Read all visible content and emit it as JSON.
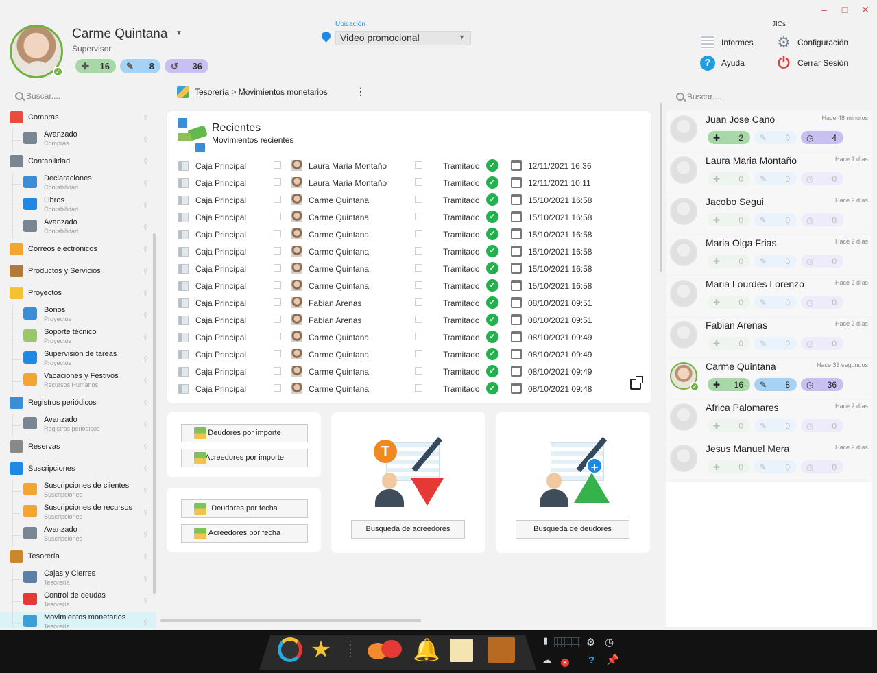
{
  "window": {
    "minimize": "–",
    "maximize": "□",
    "close": "✕"
  },
  "profile": {
    "name": "Carme Quintana",
    "role": "Supervisor",
    "badges": {
      "created": "16",
      "edited": "8",
      "history": "36"
    }
  },
  "location": {
    "label": "Ubicación",
    "value": "Video promocional"
  },
  "topmenu": {
    "group_label": "JICs",
    "informes": "Informes",
    "configuracion": "Configuración",
    "ayuda": "Ayuda",
    "cerrar": "Cerrar Sesión"
  },
  "sidebar": {
    "search_placeholder": "Buscar....",
    "items": [
      {
        "label": "Compras",
        "type": "top",
        "color": "#e74c3c"
      },
      {
        "label": "Avanzado",
        "sub": "Compras",
        "type": "sub",
        "color": "#7a8793"
      },
      {
        "label": "Contabilidad",
        "type": "top",
        "color": "#7a8793"
      },
      {
        "label": "Declaraciones",
        "sub": "Contabilidad",
        "type": "sub",
        "color": "#3b8ed6"
      },
      {
        "label": "Libros",
        "sub": "Contabilidad",
        "type": "sub",
        "color": "#1e88e5"
      },
      {
        "label": "Avanzado",
        "sub": "Contabilidad",
        "type": "sub",
        "color": "#7a8793"
      },
      {
        "label": "Correos electrónicos",
        "type": "top",
        "color": "#f2a530"
      },
      {
        "label": "Productos y Servicios",
        "type": "top",
        "color": "#b07a3a"
      },
      {
        "label": "Proyectos",
        "type": "top",
        "color": "#f2c230"
      },
      {
        "label": "Bonos",
        "sub": "Proyectos",
        "type": "sub",
        "color": "#3b8ed6"
      },
      {
        "label": "Soporte técnico",
        "sub": "Proyectos",
        "type": "sub",
        "color": "#9bc76a"
      },
      {
        "label": "Supervisión de tareas",
        "sub": "Proyectos",
        "type": "sub",
        "color": "#1e88e5"
      },
      {
        "label": "Vacaciones y Festivos",
        "sub": "Recursos Humanos",
        "type": "sub",
        "color": "#f2a530"
      },
      {
        "label": "Registros periódicos",
        "type": "top",
        "color": "#3b8ed6"
      },
      {
        "label": "Avanzado",
        "sub": "Registros periódicos",
        "type": "sub",
        "color": "#7a8793"
      },
      {
        "label": "Reservas",
        "type": "top",
        "color": "#888888"
      },
      {
        "label": "Suscripciones",
        "type": "top",
        "color": "#1e88e5"
      },
      {
        "label": "Suscripciones de clientes",
        "sub": "Suscripciones",
        "type": "sub",
        "color": "#f2a530"
      },
      {
        "label": "Suscripciones de recursos",
        "sub": "Suscripciones",
        "type": "sub",
        "color": "#f2a530"
      },
      {
        "label": "Avanzado",
        "sub": "Suscripciones",
        "type": "sub",
        "color": "#7a8793"
      },
      {
        "label": "Tesorería",
        "type": "top",
        "color": "#c9882e"
      },
      {
        "label": "Cajas y Cierres",
        "sub": "Tesorería",
        "type": "sub",
        "color": "#5b7fa6"
      },
      {
        "label": "Control de deudas",
        "sub": "Tesorería",
        "type": "sub",
        "color": "#e53935"
      },
      {
        "label": "Movimientos monetarios",
        "sub": "Tesorería",
        "type": "sub",
        "color": "#3ca0d8",
        "active": true
      }
    ]
  },
  "breadcrumb": {
    "text": "Tesorería > Movimientos monetarios",
    "more": "⋮"
  },
  "recent": {
    "title": "Recientes",
    "subtitle": "Movimientos recientes",
    "rows": [
      {
        "name": "Caja Principal",
        "user": "Laura Maria Montaño",
        "status": "Tramitado",
        "date": "12/11/2021 16:36"
      },
      {
        "name": "Caja Principal",
        "user": "Laura Maria Montaño",
        "status": "Tramitado",
        "date": "12/11/2021 10:11"
      },
      {
        "name": "Caja Principal",
        "user": "Carme Quintana",
        "status": "Tramitado",
        "date": "15/10/2021 16:58"
      },
      {
        "name": "Caja Principal",
        "user": "Carme Quintana",
        "status": "Tramitado",
        "date": "15/10/2021 16:58"
      },
      {
        "name": "Caja Principal",
        "user": "Carme Quintana",
        "status": "Tramitado",
        "date": "15/10/2021 16:58"
      },
      {
        "name": "Caja Principal",
        "user": "Carme Quintana",
        "status": "Tramitado",
        "date": "15/10/2021 16:58"
      },
      {
        "name": "Caja Principal",
        "user": "Carme Quintana",
        "status": "Tramitado",
        "date": "15/10/2021 16:58"
      },
      {
        "name": "Caja Principal",
        "user": "Carme Quintana",
        "status": "Tramitado",
        "date": "15/10/2021 16:58"
      },
      {
        "name": "Caja Principal",
        "user": "Fabian Arenas",
        "status": "Tramitado",
        "date": "08/10/2021 09:51"
      },
      {
        "name": "Caja Principal",
        "user": "Fabian Arenas",
        "status": "Tramitado",
        "date": "08/10/2021 09:51"
      },
      {
        "name": "Caja Principal",
        "user": "Carme Quintana",
        "status": "Tramitado",
        "date": "08/10/2021 09:49"
      },
      {
        "name": "Caja Principal",
        "user": "Carme Quintana",
        "status": "Tramitado",
        "date": "08/10/2021 09:49"
      },
      {
        "name": "Caja Principal",
        "user": "Carme Quintana",
        "status": "Tramitado",
        "date": "08/10/2021 09:49"
      },
      {
        "name": "Caja Principal",
        "user": "Carme Quintana",
        "status": "Tramitado",
        "date": "08/10/2021 09:48"
      }
    ]
  },
  "cards": {
    "deudores_importe": "Deudores por importe",
    "acreedores_importe": "Acreedores por importe",
    "deudores_fecha": "Deudores por fecha",
    "acreedores_fecha": "Acreedores por fecha",
    "busqueda_acreedores": "Busqueda de acreedores",
    "busqueda_deudores": "Busqueda de deudores",
    "t_letter": "T",
    "plus": "+"
  },
  "users": {
    "search_placeholder": "Buscar....",
    "list": [
      {
        "name": "Juan Jose Cano",
        "time": "Hace 48 minutos",
        "c": "2",
        "e": "0",
        "h": "4",
        "active": "gp"
      },
      {
        "name": "Laura Maria Montaño",
        "time": "Hace 1 días",
        "c": "0",
        "e": "0",
        "h": "0",
        "active": ""
      },
      {
        "name": "Jacobo Segui",
        "time": "Hace 2 días",
        "c": "0",
        "e": "0",
        "h": "0",
        "active": ""
      },
      {
        "name": "Maria Olga Frias",
        "time": "Hace 2 días",
        "c": "0",
        "e": "0",
        "h": "0",
        "active": ""
      },
      {
        "name": "Maria Lourdes Lorenzo",
        "time": "Hace 2 días",
        "c": "0",
        "e": "0",
        "h": "0",
        "active": ""
      },
      {
        "name": "Fabian Arenas",
        "time": "Hace 2 días",
        "c": "0",
        "e": "0",
        "h": "0",
        "active": ""
      },
      {
        "name": "Carme Quintana",
        "time": "Hace 33 segundos",
        "c": "16",
        "e": "8",
        "h": "36",
        "active": "gbp",
        "me": true
      },
      {
        "name": "Africa Palomares",
        "time": "Hace 2 días",
        "c": "0",
        "e": "0",
        "h": "0",
        "active": ""
      },
      {
        "name": "Jesus Manuel Mera",
        "time": "Hace 2 días",
        "c": "0",
        "e": "0",
        "h": "0",
        "active": ""
      }
    ]
  },
  "taskbar": {
    "help": "?",
    "close_x": "✕"
  }
}
